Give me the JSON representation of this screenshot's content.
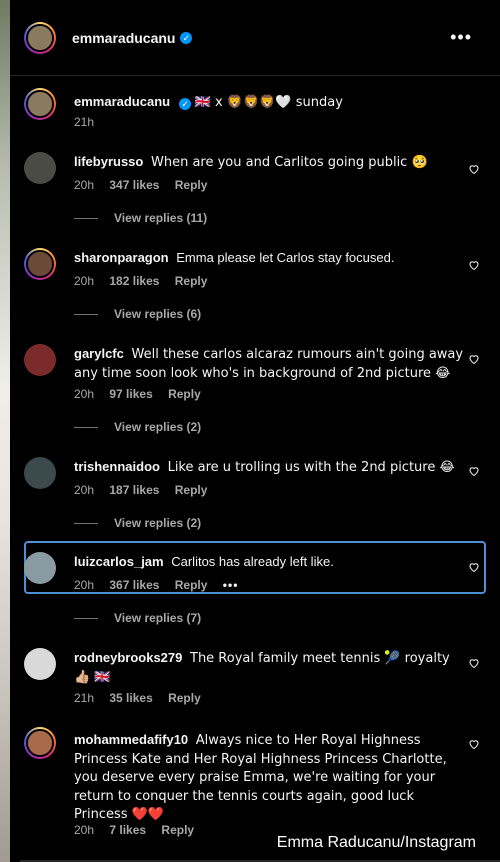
{
  "header": {
    "username": "emmaraducanu",
    "verified_badge": "✓",
    "more_label": "•••"
  },
  "caption": {
    "username": "emmaraducanu",
    "text": "🇬🇧 x 🦁🦁🦁🤍 sunday",
    "time": "21h"
  },
  "comments": [
    {
      "username": "lifebyrusso",
      "text": "When are you and Carlitos going public 🥺",
      "time": "20h",
      "likes": "347 likes",
      "reply": "Reply",
      "replies": "View replies (11)",
      "avatar_color": "#4a4b44"
    },
    {
      "username": "sharonparagon",
      "text": "Emma please let Carlos stay focused.",
      "time": "20h",
      "likes": "182 likes",
      "reply": "Reply",
      "replies": "View replies (6)",
      "avatar_color": "#6b4a3a"
    },
    {
      "username": "garylcfc",
      "text": "Well these carlos alcaraz rumours ain't going away any time soon look who's in background of 2nd picture 😂",
      "time": "20h",
      "likes": "97 likes",
      "reply": "Reply",
      "replies": "View replies (2)",
      "avatar_color": "#7a2a2a"
    },
    {
      "username": "trishennaidoo",
      "text": "Like are u trolling us with the 2nd picture 😂",
      "time": "20h",
      "likes": "187 likes",
      "reply": "Reply",
      "replies": "View replies (2)",
      "avatar_color": "#3b4a4c"
    },
    {
      "username": "luizcarlos_jam",
      "text": "Carlitos has already left like.",
      "time": "20h",
      "likes": "367 likes",
      "reply": "Reply",
      "more": "•••",
      "replies": "View replies (7)",
      "avatar_color": "#8a9aa2"
    },
    {
      "username": "rodneybrooks279",
      "text": "The Royal family meet tennis 🎾 royalty👍🏼 🇬🇧",
      "time": "21h",
      "likes": "35 likes",
      "reply": "Reply",
      "avatar_color": "#d9d9d9"
    },
    {
      "username": "mohammedafify10",
      "text": "Always nice to Her Royal Highness Princess Kate and Her Royal Highness Princess Charlotte, you deserve every praise Emma, we're waiting for your return to conquer the tennis courts again, good luck Princess ❤️❤️",
      "time": "20h",
      "likes": "7 likes",
      "reply": "Reply",
      "avatar_color": "#a86a4a"
    }
  ],
  "watermark": "Emma Raducanu/Instagram",
  "colors": {
    "verified": "#0095f6",
    "meta": "#a8a8a8",
    "highlight": "#4f8fd6"
  }
}
